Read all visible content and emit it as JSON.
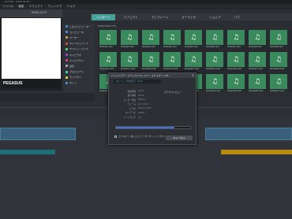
{
  "window": {
    "title": "... PLAYER - 2020-09-04 ..."
  },
  "menu": [
    "ファイル",
    "編集",
    "エフェクト",
    "ウィンドウ",
    "ヘルプ"
  ],
  "preview": {
    "time": "00:00:13.07",
    "logo": "PEGASUS"
  },
  "tabs": [
    "インポート",
    "エフェクト",
    "テンプレート",
    "オーディオ",
    "ショップ",
    "ハブ"
  ],
  "breadcrumb": "EXPLORER FITS",
  "sidebar": [
    {
      "label": "このコンピューター",
      "color": "#4a90d9"
    },
    {
      "label": "コンピュータ",
      "color": "#4a90d9"
    },
    {
      "label": "ユーザー",
      "color": "#d9a54a"
    },
    {
      "label": "マイドキュメント",
      "color": "#d94a4a"
    },
    {
      "label": "マイミュージック",
      "color": "#4ad98a"
    },
    {
      "label": "マイビデオ",
      "color": "#8a4ad9"
    },
    {
      "label": "マイピクチャ",
      "color": "#d94a9a"
    },
    {
      "label": "最近",
      "color": "#aaaaaa"
    },
    {
      "label": "プロジェクト",
      "color": "#4ad9d9"
    },
    {
      "label": "ライブラリ",
      "color": "#d9d94a"
    },
    {
      "label": "ネット",
      "color": "#4a90d9"
    }
  ],
  "thumbs": [
    "Sample1.mp3",
    "Sample2.mp3",
    "Sample3.mp3",
    "Sample4.mp3",
    "Sample5.mp3",
    "Sample6.mp3",
    "Sample7.mp3",
    "Sample8.mp3",
    "Sample9.mp3",
    "Sample10.mp3",
    "Sample11.mp3",
    "Sample12.mp3",
    "Sample13.mp3",
    "Sample14.mp3",
    "Sample15.mp3",
    "Sample16.mp3",
    "Sample17.mp3",
    "Sample18.mp3",
    "Sample19.mp3",
    "Sample20.mp3",
    "Sample21.mp3",
    "Sample22.mp3",
    "Sample23.mp3",
    "Sample24.mp3",
    "Sample25.mp3",
    "Sample26.mp3",
    "Sample27.mp3"
  ],
  "dialog": {
    "title": "ソリッドステートディスクプレイヤー エクスポート中...",
    "file": "ブルーレイ形式完了.mp4",
    "preview_label": "ビデオプレビュー",
    "fields": [
      {
        "k": "経過時間",
        "v": "00:00"
      },
      {
        "k": "残り時間",
        "v": "00:00"
      },
      {
        "k": "ムービー形式",
        "v": "MPEG-4"
      },
      {
        "k": "フレーム",
        "v": "00 / 1200"
      },
      {
        "k": "ビデオ",
        "v": "1920 x 1080"
      },
      {
        "k": "オーディオ",
        "v": "48000"
      },
      {
        "k": "ハードウェア",
        "v": "オン"
      }
    ],
    "progress": 0.79,
    "checkbox_label": "エクスポート後にコンピューターをシャットダウン",
    "cancel": "キャンセル"
  }
}
